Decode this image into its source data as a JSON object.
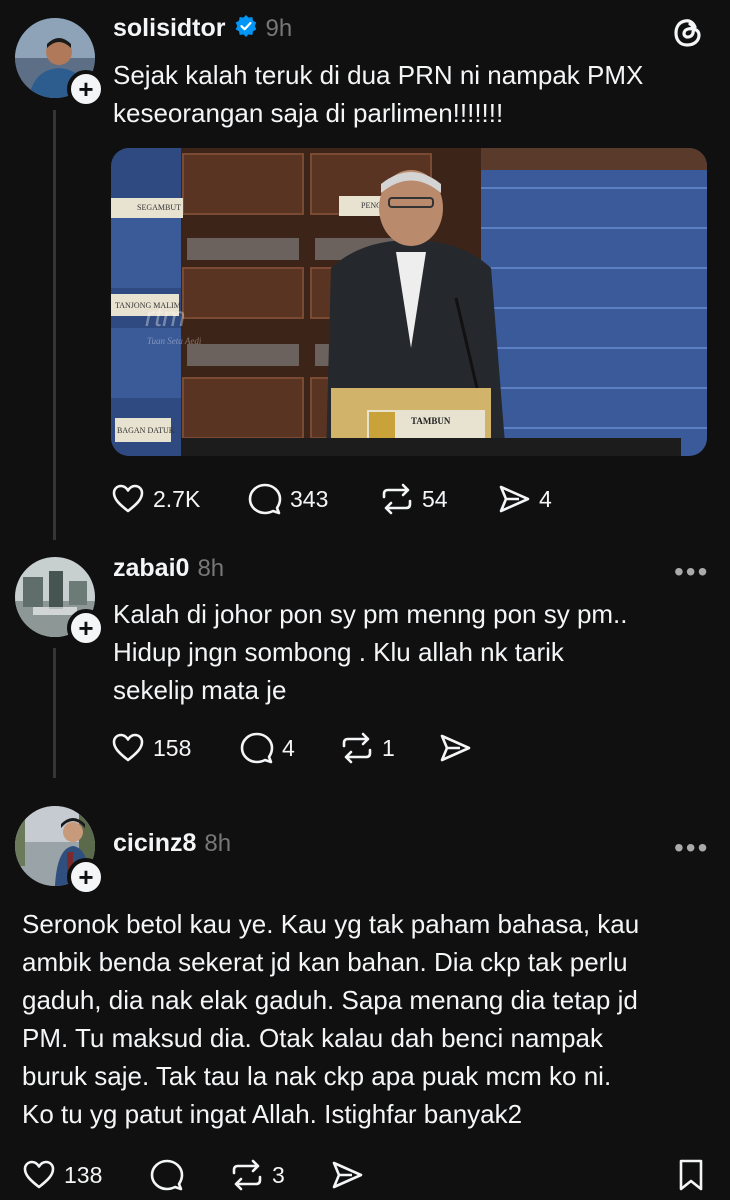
{
  "app": {
    "logo_icon": "threads-logo-icon"
  },
  "posts": [
    {
      "username": "solisidtor",
      "verified": true,
      "time": "9h",
      "text_lines": [
        "Sejak kalah teruk di dua PRN ni nampak PMX",
        "keseorangan saja di parlimen!!!!!!!"
      ],
      "image": {
        "nameplates": [
          "TAMBUN",
          "TANJONG MALIM",
          "PENGERANG",
          "SEGAMBUT",
          "BAGAN DATUK"
        ],
        "watermark": "rtm",
        "watermark_sub": "Tuan Seta Aedi"
      },
      "likes": "2.7K",
      "comments": "343",
      "reposts": "54",
      "shares": "4"
    },
    {
      "username": "zabai0",
      "time": "8h",
      "text_lines": [
        "Kalah di johor pon sy pm menng pon sy pm..",
        "Hidup jngn sombong . Klu allah nk tarik",
        "sekelip mata je"
      ],
      "likes": "158",
      "comments": "4",
      "reposts": "1",
      "more": "•••"
    },
    {
      "username": "cicinz8",
      "time": "8h",
      "text_lines": [
        "Seronok betol kau ye. Kau yg tak paham bahasa, kau",
        "ambik benda sekerat jd kan bahan. Dia ckp tak perlu",
        "gaduh, dia nak elak gaduh. Sapa menang dia tetap jd",
        "PM. Tu maksud dia. Otak kalau dah benci nampak",
        "buruk saje. Tak tau la nak  ckp apa puak mcm ko ni.",
        "Ko tu yg patut ingat Allah. Istighfar banyak2"
      ],
      "likes": "138",
      "reposts": "3",
      "more": "•••"
    }
  ],
  "colors": {
    "background": "#101010",
    "text": "#f3f5f7",
    "muted": "#777777",
    "verified": "#0095f6"
  }
}
